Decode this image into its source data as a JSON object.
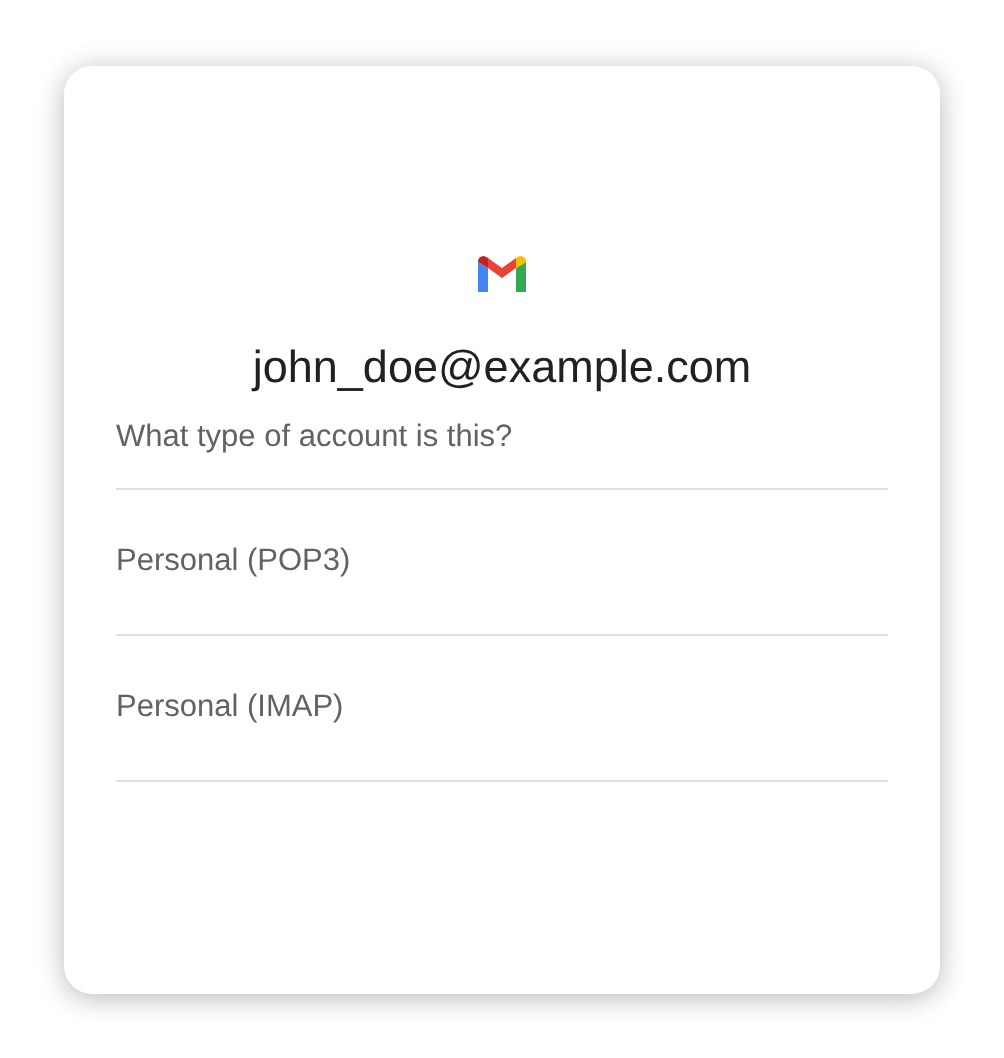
{
  "account": {
    "email": "john_doe@example.com",
    "question": "What type of account is this?"
  },
  "options": [
    {
      "label": "Personal (POP3)"
    },
    {
      "label": "Personal (IMAP)"
    }
  ]
}
